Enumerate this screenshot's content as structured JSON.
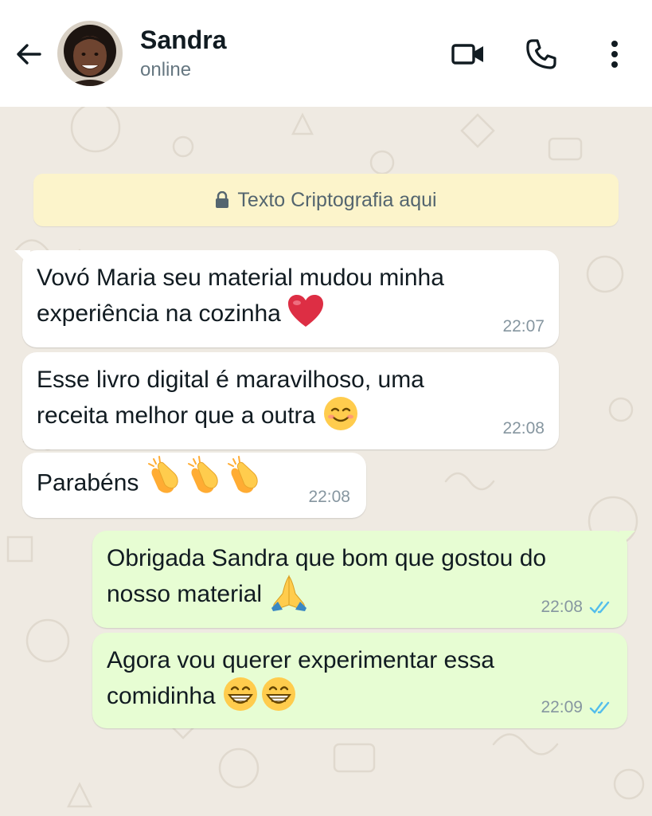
{
  "header": {
    "contact_name": "Sandra",
    "status": "online"
  },
  "encryption_notice": "Texto Criptografia aqui",
  "messages": [
    {
      "direction": "in",
      "line1": "Vovó Maria seu material mudou minha",
      "line2": "experiência na cozinha",
      "emoji": "red-heart",
      "time": "22:07"
    },
    {
      "direction": "in",
      "line1": "Esse livro digital é maravilhoso, uma",
      "line2": "receita melhor que a outra",
      "emoji": "smiling-face",
      "time": "22:08"
    },
    {
      "direction": "in",
      "line1": "Parabéns",
      "emoji": "clapping-hands x3",
      "time": "22:08"
    },
    {
      "direction": "out",
      "line1": "Obrigada Sandra que bom que gostou do",
      "line2": "nosso material",
      "emoji": "folded-hands",
      "time": "22:08",
      "status": "read"
    },
    {
      "direction": "out",
      "line1": "Agora vou querer experimentar essa",
      "line2": "comidinha",
      "emoji": "grinning-face x2",
      "time": "22:09",
      "status": "read"
    }
  ],
  "colors": {
    "chat_background": "#efeae2",
    "incoming_bubble": "#ffffff",
    "outgoing_bubble": "#e7fdd3",
    "encryption_banner": "#fcf4cb",
    "read_ticks": "#53bdeb"
  }
}
